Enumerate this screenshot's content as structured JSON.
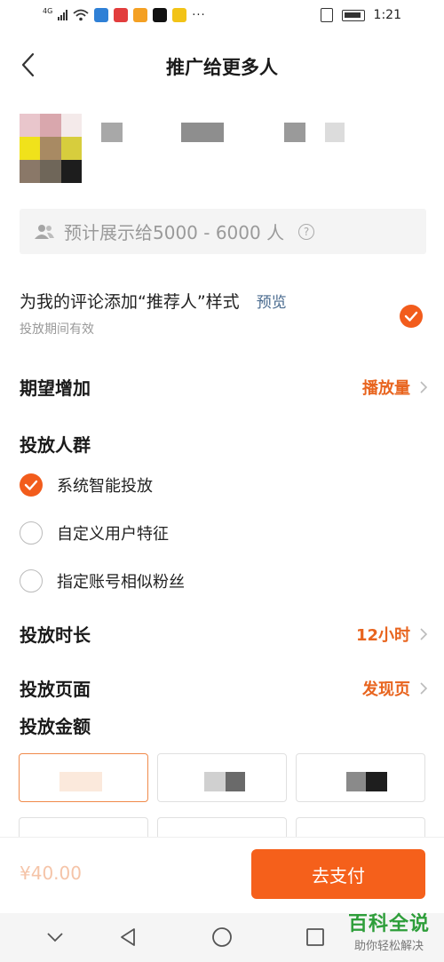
{
  "status_bar": {
    "signal_tag": "4G",
    "more": "···",
    "time": "1:21",
    "icons": [
      "signal-icon",
      "wifi-icon",
      "app-notification-icons",
      "vibrate-icon",
      "battery-icon"
    ]
  },
  "nav": {
    "title": "推广给更多人",
    "back_icon": "chevron-left-icon"
  },
  "estimate": {
    "text": "预计展示给5000 - 6000 人",
    "help_icon": "question-icon",
    "icon": "users-icon"
  },
  "recommender": {
    "text": "为我的评论添加“推荐人”样式",
    "preview_label": "预览",
    "sub": "投放期间有效",
    "checked": true
  },
  "expect": {
    "label": "期望增加",
    "value": "播放量"
  },
  "audience": {
    "label": "投放人群",
    "options": [
      {
        "label": "系统智能投放",
        "selected": true
      },
      {
        "label": "自定义用户特征",
        "selected": false
      },
      {
        "label": "指定账号相似粉丝",
        "selected": false
      }
    ]
  },
  "duration": {
    "label": "投放时长",
    "value": "12小时"
  },
  "page": {
    "label": "投放页面",
    "value": "发现页"
  },
  "amount": {
    "label": "投放金额"
  },
  "bottom": {
    "price": "¥40.00",
    "pay_label": "去支付"
  },
  "watermark": {
    "title": "百科全说",
    "subtitle": "助你轻松解决"
  },
  "colors": {
    "accent": "#f25c1c",
    "accent_text": "#e8641e",
    "link": "#4a6b8f",
    "watermark_green": "#2e9e3a"
  }
}
